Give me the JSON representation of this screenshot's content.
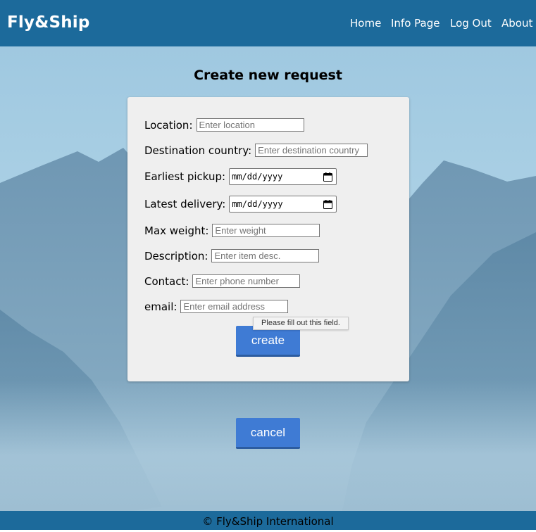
{
  "nav": {
    "brand": "Fly&Ship",
    "links": [
      "Home",
      "Info Page",
      "Log Out",
      "About"
    ]
  },
  "page_title": "Create new request",
  "form": {
    "location": {
      "label": "Location:",
      "placeholder": "Enter location"
    },
    "destination": {
      "label": "Destination country:",
      "placeholder": "Enter destination country"
    },
    "earliest_pickup": {
      "label": "Earliest pickup:",
      "value": "mm/dd/yyyy"
    },
    "latest_delivery": {
      "label": "Latest delivery:",
      "value": "mm/dd/yyyy"
    },
    "max_weight": {
      "label": "Max weight:",
      "placeholder": "Enter weight"
    },
    "description": {
      "label": "Description:",
      "placeholder": "Enter item desc."
    },
    "contact": {
      "label": "Contact:",
      "placeholder": "Enter phone number"
    },
    "email": {
      "label": "email:",
      "placeholder": "Enter email address"
    },
    "create_label": "create",
    "validation_tooltip": "Please fill out this field."
  },
  "cancel_label": "cancel",
  "footer": "© Fly&Ship International",
  "colors": {
    "navbar": "#1c6a9b",
    "button": "#3f7bd4",
    "card": "#efefef"
  },
  "icons": [
    "calendar-icon"
  ]
}
